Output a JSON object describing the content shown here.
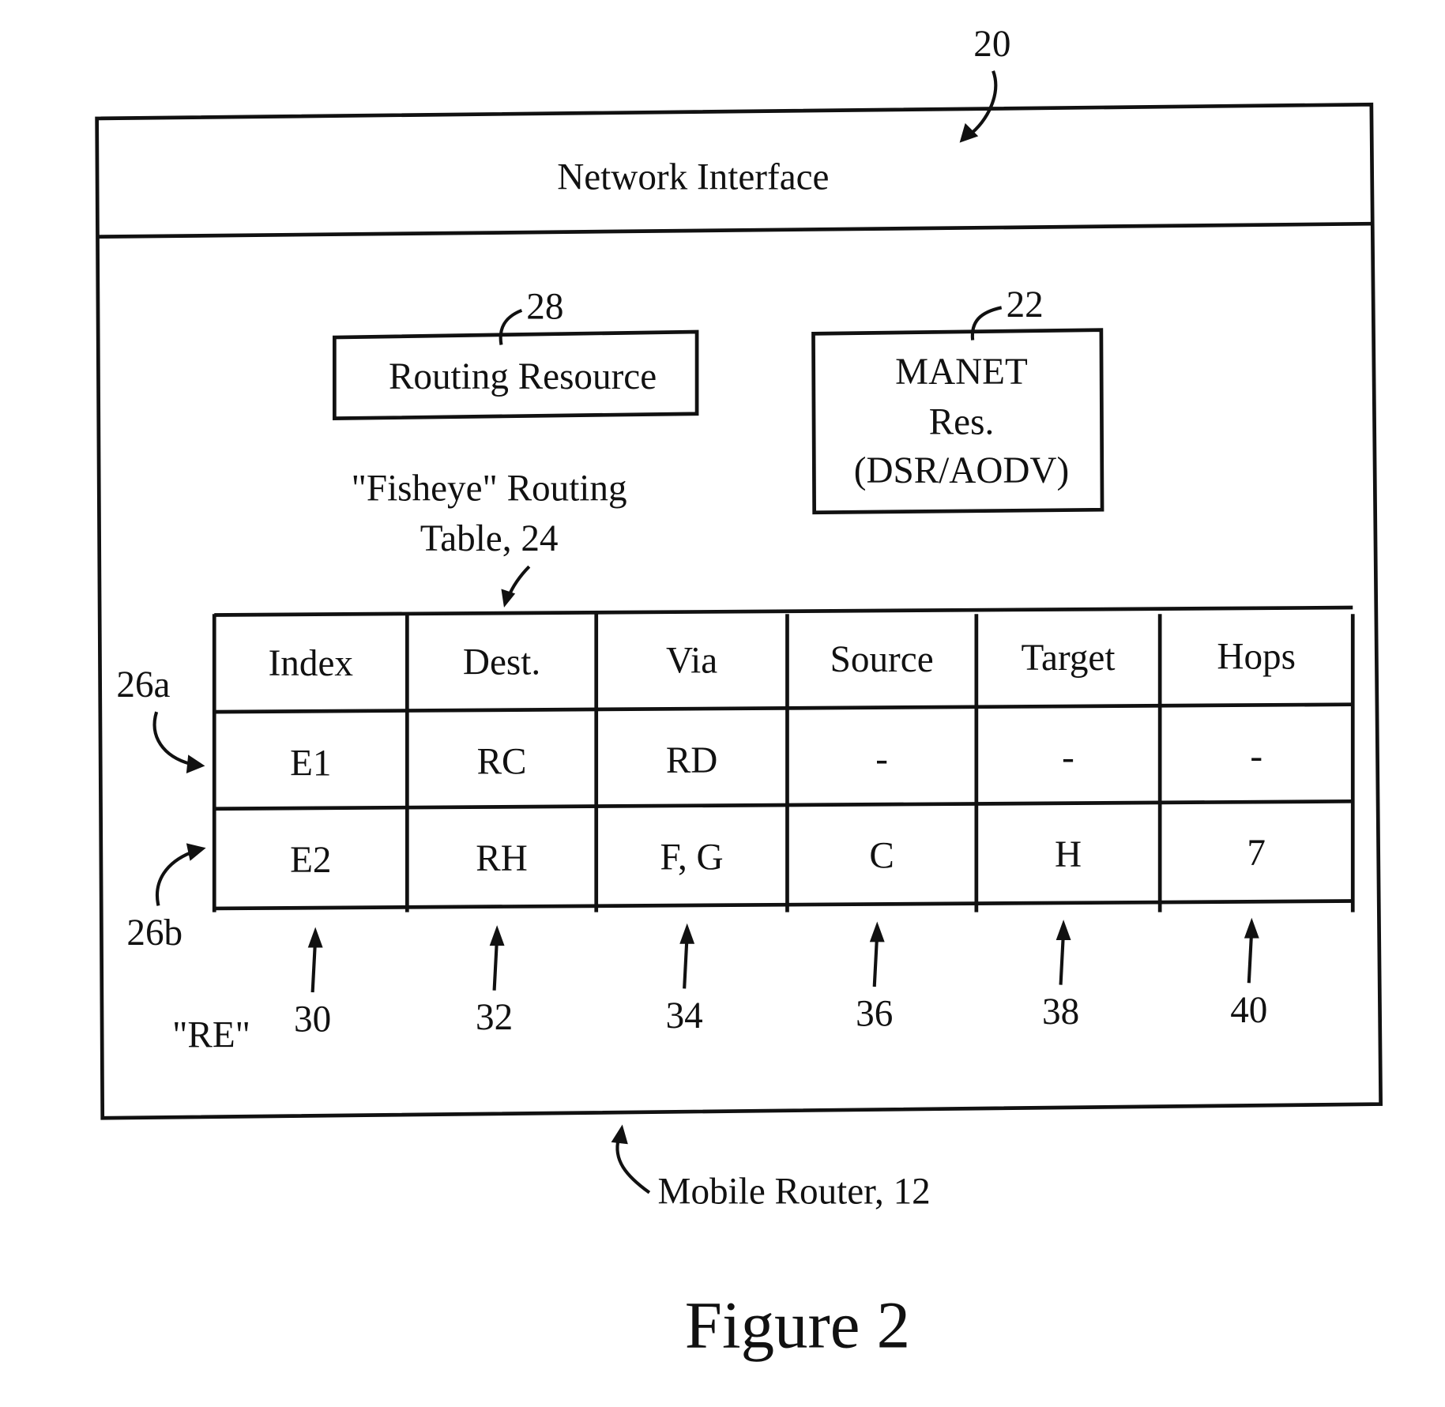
{
  "figure": {
    "title": "Figure 2",
    "ref_device": "20",
    "network_interface": "Network Interface",
    "routing_resource": {
      "label": "Routing Resource",
      "ref": "28"
    },
    "manet_resource": {
      "lines": [
        "MANET",
        "Res.",
        "(DSR/AODV)"
      ],
      "ref": "22"
    },
    "routing_table_caption": {
      "line1": "\"Fisheye\" Routing",
      "line2": "Table, 24"
    },
    "mobile_router_label": "Mobile Router, 12",
    "re_label": "\"RE\"",
    "row_refs": [
      "26a",
      "26b"
    ],
    "table": {
      "columns": [
        "Index",
        "Dest.",
        "Via",
        "Source",
        "Target",
        "Hops"
      ],
      "rows": [
        [
          "E1",
          "RC",
          "RD",
          "-",
          "-",
          "-"
        ],
        [
          "E2",
          "RH",
          "F, G",
          "C",
          "H",
          "7"
        ]
      ],
      "column_refs": [
        "30",
        "32",
        "34",
        "36",
        "38",
        "40"
      ]
    }
  }
}
